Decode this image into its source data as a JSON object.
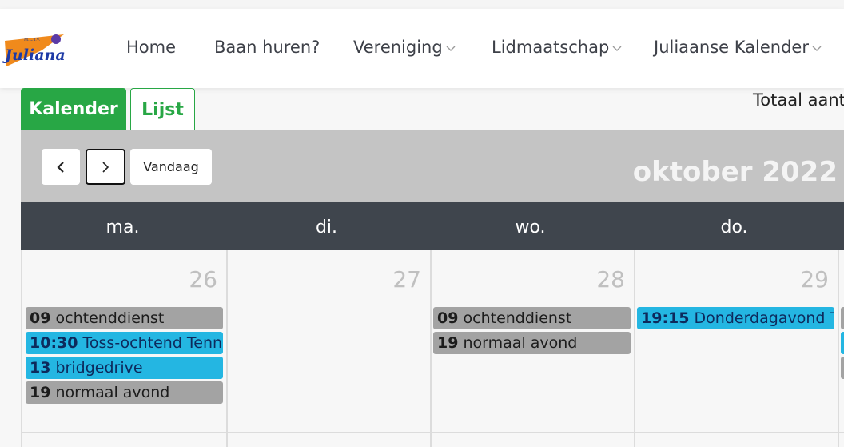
{
  "navbar": {
    "logo_text": "Juliana",
    "logo_small": "M.L.T.V.",
    "items": [
      {
        "label": "Home",
        "has_dropdown": false
      },
      {
        "label": "Baan huren?",
        "has_dropdown": false
      },
      {
        "label": "Vereniging",
        "has_dropdown": true
      },
      {
        "label": "Lidmaatschap",
        "has_dropdown": true
      },
      {
        "label": "Juliaanse Kalender",
        "has_dropdown": true
      }
    ]
  },
  "tabs": {
    "kalender": "Kalender",
    "lijst": "Lijst"
  },
  "totaal_text": "Totaal aant",
  "toolbar": {
    "prev_icon": "chevron-left-icon",
    "next_icon": "chevron-right-icon",
    "today_label": "Vandaag",
    "title": "oktober 2022"
  },
  "day_headers": [
    "ma.",
    "di.",
    "wo.",
    "do."
  ],
  "days": [
    {
      "number": "26",
      "events": [
        {
          "time": "09",
          "title": "ochtenddienst",
          "color": "grey"
        },
        {
          "time": "10:30",
          "title": "Toss-ochtend Tennis",
          "color": "blue"
        },
        {
          "time": "13",
          "title": "bridgedrive",
          "color": "blue"
        },
        {
          "time": "19",
          "title": "normaal avond",
          "color": "grey"
        }
      ]
    },
    {
      "number": "27",
      "events": []
    },
    {
      "number": "28",
      "events": [
        {
          "time": "09",
          "title": "ochtenddienst",
          "color": "grey"
        },
        {
          "time": "19",
          "title": "normaal avond",
          "color": "grey"
        }
      ]
    },
    {
      "number": "29",
      "events": [
        {
          "time": "19:15",
          "title": "Donderdagavond Te",
          "color": "blue"
        }
      ]
    }
  ],
  "colors": {
    "accent_green": "#28a745",
    "event_grey": "#a3a3a3",
    "event_blue": "#24b6e2",
    "header_dark": "#3f454d",
    "toolbar_grey": "#c4c4c4"
  }
}
